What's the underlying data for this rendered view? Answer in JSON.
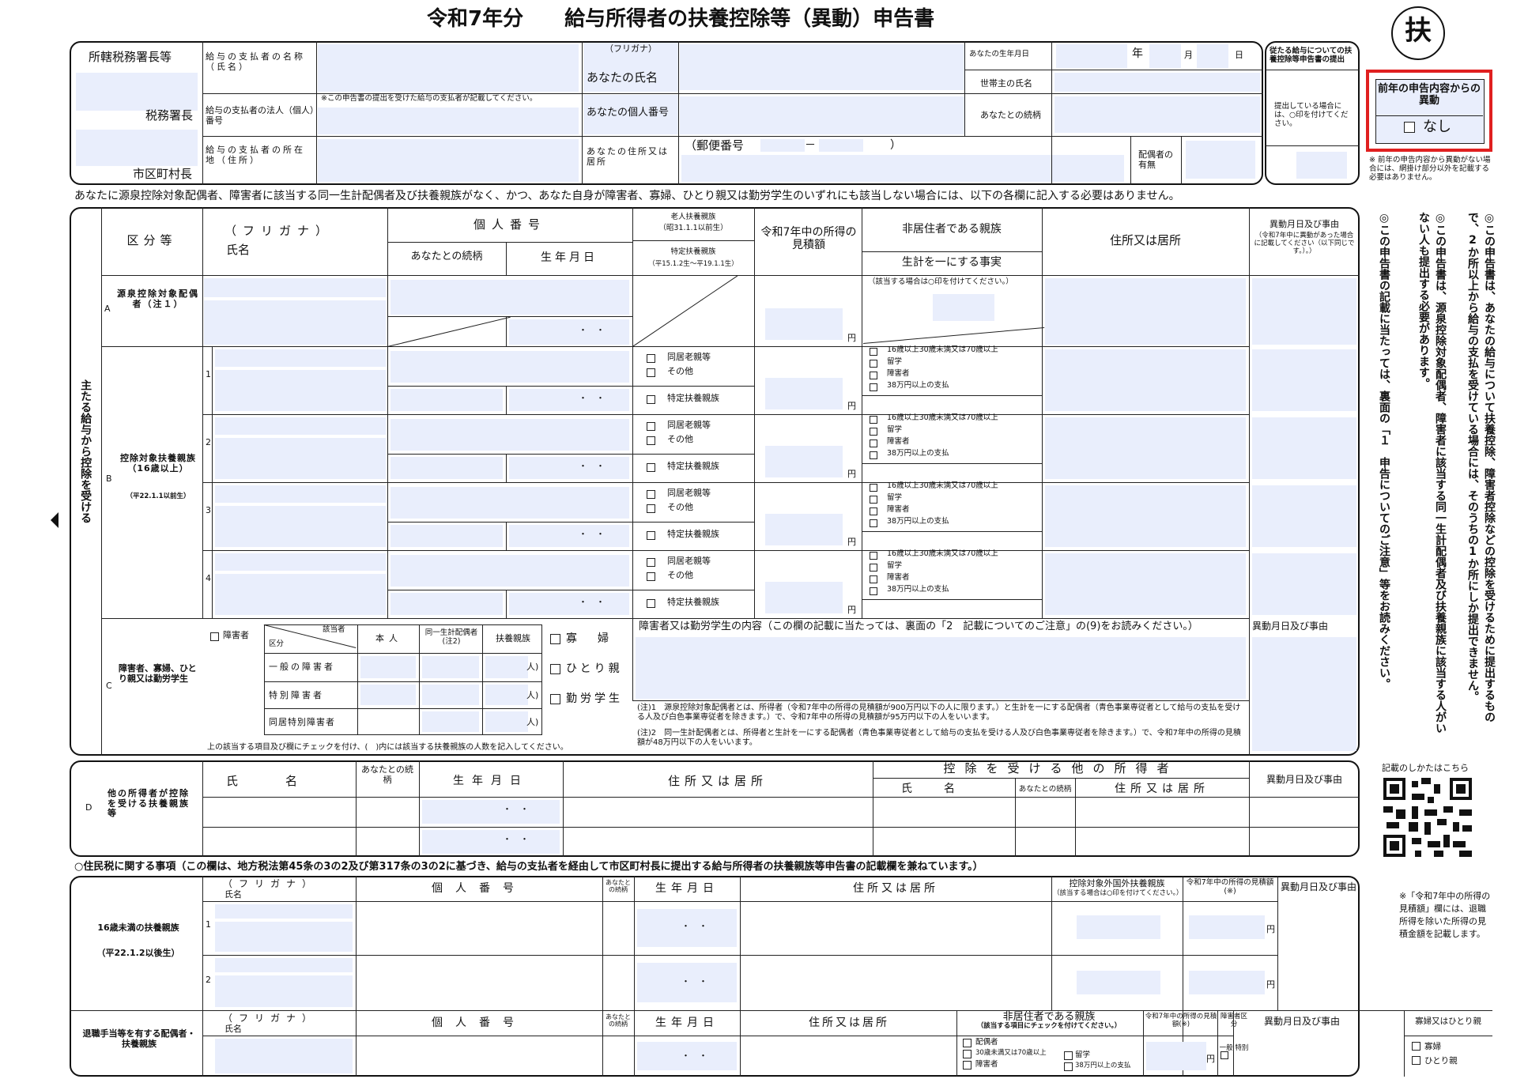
{
  "title": "令和7年分　　給与所得者の扶養控除等（異動）申告書",
  "badge": "扶",
  "no_change": {
    "title": "前年の申告内容からの異動",
    "option": "なし",
    "note": "※ 前年の申告内容から異動がない場合には、網掛け部分以外を記載する必要はありません。"
  },
  "header": {
    "tax_office": "所轄税務署長等",
    "tax_office_suffix": "税務署長",
    "city_suffix": "市区町村長",
    "payer_name": "給与の支払者の名称（氏名）",
    "payer_number": "給与の支払者の法人（個人）番号",
    "payer_number_note": "※この申告書の提出を受けた給与の支払者が記載してください。",
    "payer_address": "給与の支払者の所在地（住所）",
    "furigana": "（フリガナ）",
    "your_name": "あなたの氏名",
    "your_number": "あなたの個人番号",
    "your_address": "あなたの住所又は居所",
    "postal": "（郵便番号",
    "postal_dash": "－",
    "postal_close": "）",
    "birth_label": "あなたの生年月日",
    "year": "年",
    "month": "月",
    "day": "日",
    "householder": "世帯主の氏名",
    "relation": "あなたとの続柄",
    "spouse": "配偶者の有無",
    "submit_title": "従たる給与についての扶養控除等申告書の提出",
    "submit_note": "提出している場合には、○印を付けてください。"
  },
  "notice": "あなたに源泉控除対象配偶者、障害者に該当する同一生計配偶者及び扶養親族がなく、かつ、あなた自身が障害者、寡婦、ひとり親又は勤労学生のいずれにも該当しない場合には、以下の各欄に記入する必要はありません。",
  "main": {
    "side_label": "主たる給与から控除を受ける",
    "col_kubun": "区分等",
    "col_name_furi": "（フリガナ）",
    "col_name": "氏名",
    "col_number": "個人番号",
    "col_relation": "あなたとの続柄",
    "col_birth": "生年月日",
    "col_elderly": "老人扶養親族",
    "col_elderly_date": "（昭31.1.1以前生）",
    "col_specific": "特定扶養親族",
    "col_specific_date": "（平15.1.2生～平19.1.1生）",
    "col_income": "令和7年中の所得の見積額",
    "col_nonres": "非居住者である親族",
    "col_livelihood": "生計を一にする事実",
    "col_address": "住所又は居所",
    "col_change": "異動月日及び事由",
    "col_change_note": "（令和7年中に異動があった場合に記載してください（以下同じです。）。）",
    "nonres_note": "（該当する場合は○印を付けてください。）",
    "rowA": "源泉控除対象配偶者（注１）",
    "rowA_letter": "A",
    "rowB": "控除対象扶養親族（16歳以上）",
    "rowB_date": "（平22.1.1以前生）",
    "rowB_letter": "B",
    "rowC": "障害者、寡婦、ひとり親又は勤労学生",
    "rowC_letter": "C",
    "yen": "円",
    "dots": "・　・",
    "opt_elderly": "同居老親等",
    "opt_other": "その他",
    "opt_specific": "特定扶養親族",
    "nr_opts": [
      "16歳以上30歳未満又は70歳以上",
      "留学",
      "障害者",
      "38万円以上の支払"
    ],
    "b_nums": [
      "1",
      "2",
      "3",
      "4"
    ],
    "c_disabled": "障害者",
    "c_kubun": "区分",
    "c_applicable": "該当者",
    "c_self": "本人",
    "c_spouse": "同一生計配偶者(注2)",
    "c_dep": "扶養親族",
    "c_rows": [
      "一般の障害者",
      "特別障害者",
      "同居特別障害者"
    ],
    "c_person": "人)",
    "c_widow": "寡婦",
    "c_single": "ひとり親",
    "c_student": "勤労学生",
    "c_detail": "障害者又は勤労学生の内容（この欄の記載に当たっては、裏面の「2　記載についてのご注意」の(9)をお読みください。）",
    "c_footer": "上の該当する項目及び欄にチェックを付け、(　)内には該当する扶養親族の人数を記入してください。",
    "note1": "(注)1　源泉控除対象配偶者とは、所得者（令和7年中の所得の見積額が900万円以下の人に限ります。）と生計を一にする配偶者（青色事業専従者として給与の支払を受ける人及び白色事業専従者を除きます。）で、令和7年中の所得の見積額が95万円以下の人をいいます。",
    "note2": "(注)2　同一生計配偶者とは、所得者と生計を一にする配偶者（青色事業専従者として給与の支払を受ける人及び白色事業専従者を除きます。）で、令和7年中の所得の見積額が48万円以下の人をいいます。"
  },
  "sectionD": {
    "letter": "D",
    "label": "他の所得者が控除を受ける扶養親族等",
    "col_name": "氏名",
    "col_relation": "あなたとの続柄",
    "col_birth": "生年月日",
    "col_address": "住所又は居所",
    "col_other": "控除を受ける他の所得者",
    "col_o_name": "氏名",
    "col_o_rel": "あなたとの続柄",
    "col_o_addr": "住所又は居所",
    "col_change": "異動月日及び事由"
  },
  "resident": {
    "heading": "○住民税に関する事項（この欄は、地方税法第45条の3の2及び第317条の3の2に基づき、給与の支払者を経由して市区町村長に提出する給与所得者の扶養親族等申告書の記載欄を兼ねています。）",
    "under16": "16歳未満の扶養親族",
    "under16_date": "（平22.1.2以後生）",
    "col_furi": "（フリガナ）",
    "col_name": "氏名",
    "col_number": "個人番号",
    "col_rel": "あなたとの続柄",
    "col_birth": "生年月日",
    "col_address": "住所又は居所",
    "col_foreign": "控除対象外国外扶養親族",
    "col_foreign_note": "（該当する場合は○印を付けてください。）",
    "col_income": "令和7年中の所得の見積額(※)",
    "col_change": "異動月日及び事由",
    "nums": [
      "1",
      "2"
    ],
    "retire": "退職手当等を有する配偶者・扶養親族",
    "retire_nonres": "非居住者である親族",
    "retire_nonres_note": "（該当する項目にチェックを付けてください。）",
    "retire_opts": [
      "配偶者",
      "30歳未満又は70歳以上",
      "障害者",
      "留学",
      "38万円以上の支払"
    ],
    "retire_income": "令和7年中の所得の見積額(※)",
    "retire_kubun": "障害者区分",
    "retire_kubun_opts": "一般 特別",
    "widow_head": "寡婦又はひとり親",
    "widow_opts": [
      "寡婦",
      "ひとり親"
    ],
    "side_note": "※「令和7年中の所得の見積額」欄には、退職所得を除いた所得の見積金額を記載します。"
  },
  "right_notes": {
    "n1": "◎この申告書は、あなたの給与について扶養控除、障害者控除などの控除を受けるために提出するもので、2か所以上から給与の支払を受けている場合には、そのうちの1か所にしか提出できません。",
    "n2": "◎この申告書は、源泉控除対象配偶者、障害者に該当する同一生計配偶者及び扶養親族に該当する人がいない人も提出する必要があります。",
    "n3": "◎この申告書の記載に当たっては、裏面の「１　申告についてのご注意」等をお読みください。",
    "qr_label": "記載のしかたはこちら"
  }
}
